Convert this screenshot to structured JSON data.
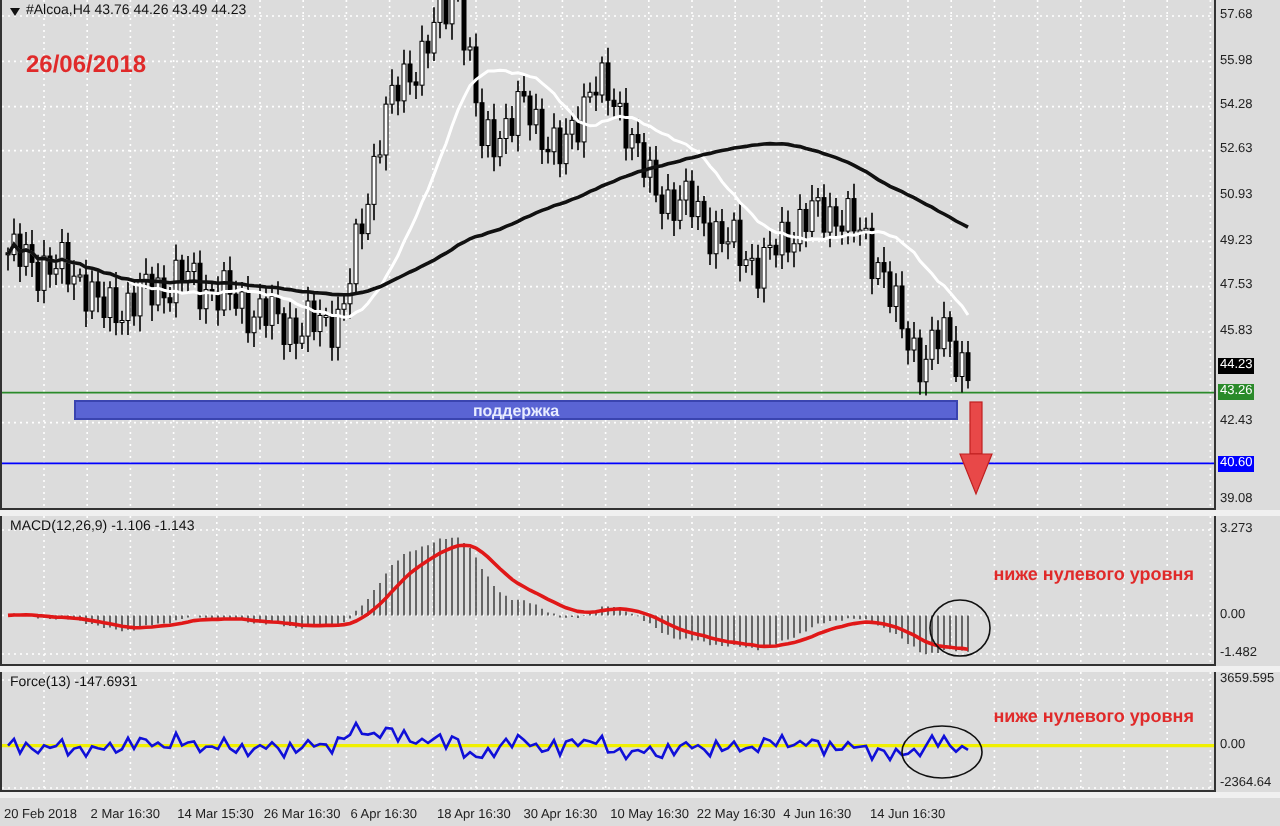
{
  "header": {
    "symbol_quote": "#Alcoa,H4 43.76 44.26 43.49 44.23"
  },
  "main_chart": {
    "date_note": "26/06/2018",
    "support_label": "поддержка",
    "price_ticks": [
      "57.68",
      "55.98",
      "54.28",
      "52.63",
      "50.93",
      "49.23",
      "47.53",
      "45.83",
      "42.43",
      "39.08"
    ],
    "price_tags": [
      {
        "text": "44.23",
        "color": "#000000"
      },
      {
        "text": "43.26",
        "color": "#2a8a2a"
      },
      {
        "text": "40.60",
        "color": "#0000ff"
      }
    ]
  },
  "macd": {
    "title": "MACD(12,26,9) -1.106 -1.143",
    "note": "ниже нулевого уровня",
    "ticks": [
      "3.273",
      "0.00",
      "-1.482"
    ]
  },
  "force": {
    "title": "Force(13) -147.6931",
    "note": "ниже нулевого уровня",
    "ticks": [
      "3659.595",
      "0.00",
      "-2364.64"
    ]
  },
  "time_axis": {
    "labels": [
      "20 Feb 2018",
      "2 Mar 16:30",
      "14 Mar 15:30",
      "26 Mar 16:30",
      "6 Apr 16:30",
      "18 Apr 16:30",
      "30 Apr 16:30",
      "10 May 16:30",
      "22 May 16:30",
      "4 Jun 16:30",
      "14 Jun 16:30"
    ]
  }
}
